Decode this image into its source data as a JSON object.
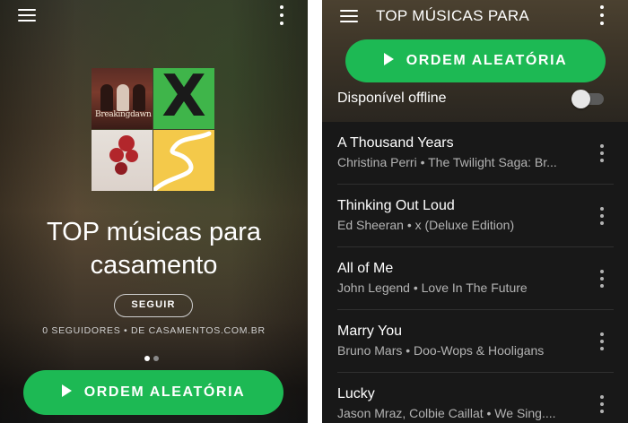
{
  "left_screen": {
    "playlist_title": "TOP músicas para casamento",
    "follow_label": "SEGUIR",
    "followers_text": "0 SEGUIDORES • DE CASAMENTOS.COM.BR",
    "cover_tile_text": "Breakingdawn",
    "shuffle_label": "ORDEM ALEATÓRIA",
    "page_indicator": {
      "pages": 2,
      "current": 1
    }
  },
  "right_screen": {
    "header_title": "TOP MÚSICAS PARA",
    "shuffle_label": "ORDEM ALEATÓRIA",
    "offline_label": "Disponível offline",
    "offline_enabled": false,
    "tracks": [
      {
        "title": "A Thousand Years",
        "subtitle": "Christina Perri • The Twilight Saga: Br..."
      },
      {
        "title": "Thinking Out Loud",
        "subtitle": "Ed Sheeran • x (Deluxe Edition)"
      },
      {
        "title": "All of Me",
        "subtitle": "John Legend • Love In The Future"
      },
      {
        "title": "Marry You",
        "subtitle": "Bruno Mars • Doo-Wops & Hooligans"
      },
      {
        "title": "Lucky",
        "subtitle": "Jason Mraz, Colbie Caillat • We Sing...."
      }
    ]
  },
  "icons": {
    "menu": "hamburger-menu-icon",
    "more": "more-vertical-icon",
    "play": "play-icon"
  },
  "colors": {
    "accent_green": "#1db954",
    "list_background": "#181818",
    "subtitle_gray": "#b3b3b3"
  }
}
